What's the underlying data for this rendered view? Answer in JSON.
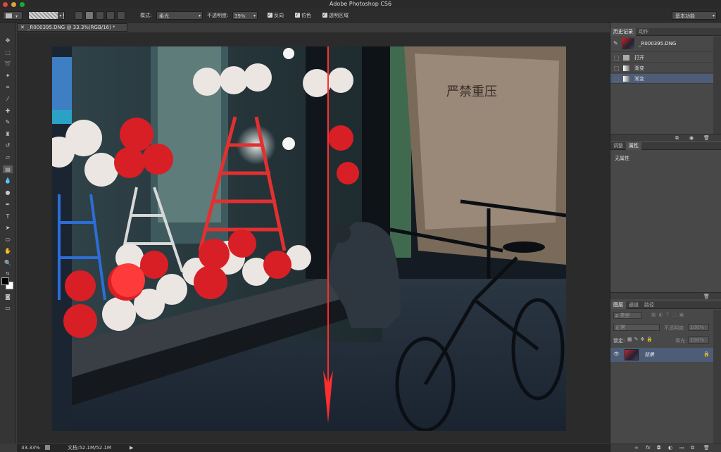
{
  "app": {
    "title": "Adobe Photoshop CS6",
    "workspace": "基本功能"
  },
  "options": {
    "mode_label": "模式:",
    "mode_value": "柔光",
    "opacity_label": "不透明度:",
    "opacity_value": "39%",
    "reverse_label": "反向",
    "dither_label": "仿色",
    "transparency_label": "透明区域"
  },
  "document": {
    "tab_title": "_R000395.DNG @ 33.3%(RGB/16) *",
    "zoom": "33.33%",
    "doc_size": "文档:52.1M/52.1M"
  },
  "history": {
    "tabs": [
      "历史记录",
      "动作"
    ],
    "snapshot_name": "_R000395.DNG",
    "items": [
      "打开",
      "渐变",
      "渐变"
    ]
  },
  "properties": {
    "tabs": [
      "调整",
      "属性"
    ],
    "empty_text": "无属性"
  },
  "layers": {
    "tabs": [
      "图层",
      "通道",
      "路径"
    ],
    "filter_kind": "ρ 类型",
    "blend_mode": "正常",
    "opacity_label": "不透明度:",
    "opacity_value": "100%",
    "lock_label": "锁定:",
    "fill_label": "填充:",
    "fill_value": "100%",
    "layer_name": "背景"
  },
  "colors": {
    "accent": "#ff2d2d",
    "panel_bg": "#484848",
    "selected_row": "#4d5d78"
  }
}
